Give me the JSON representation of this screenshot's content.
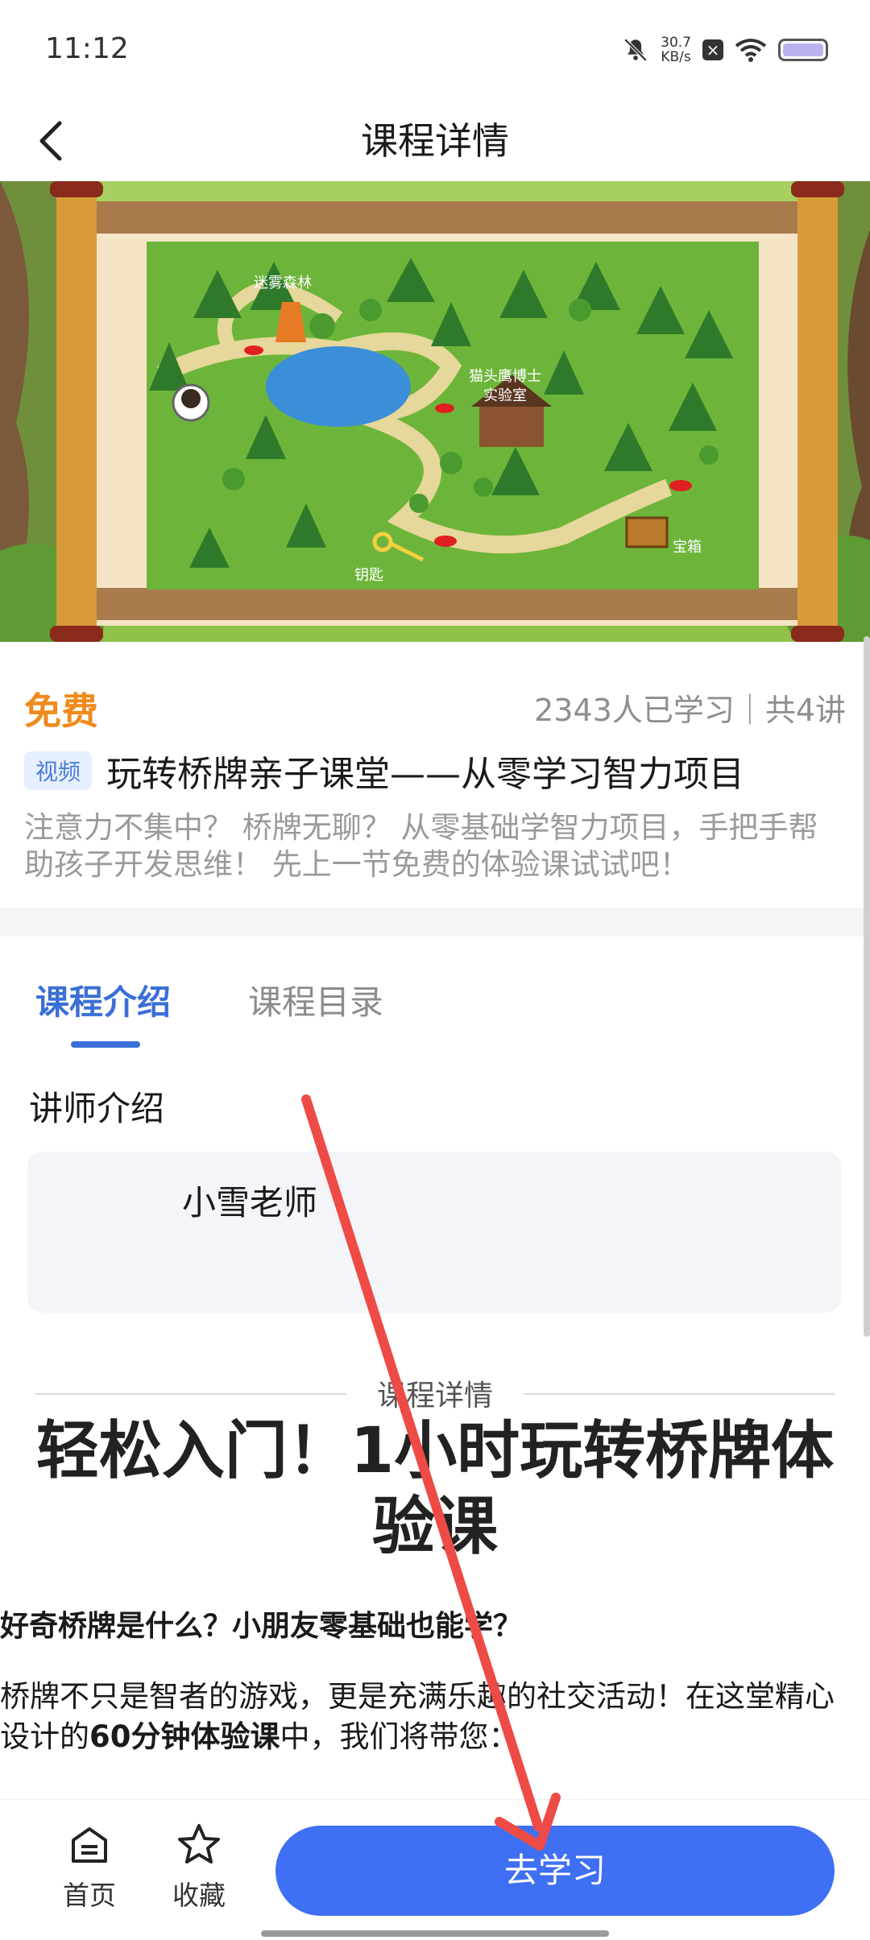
{
  "status": {
    "time": "11:12",
    "speed_value": "30.7",
    "speed_unit": "KB/s"
  },
  "nav": {
    "title": "课程详情"
  },
  "hero_map": {
    "labels": [
      "迷雾森林",
      "猫头鹰博士",
      "实验室",
      "钥匙",
      "宝箱"
    ]
  },
  "course": {
    "price": "免费",
    "stats": "2343人已学习｜共4讲",
    "tag": "视频",
    "title": "玩转桥牌亲子课堂——从零学习智力项目",
    "description": "注意力不集中？ 桥牌无聊？ 从零基础学智力项目，手把手帮助孩子开发思维！ 先上一节免费的体验课试试吧！"
  },
  "tabs": [
    {
      "label": "课程介绍",
      "active": true
    },
    {
      "label": "课程目录",
      "active": false
    }
  ],
  "teacher": {
    "section_label": "讲师介绍",
    "name": "小雪老师"
  },
  "detail": {
    "label": "课程详情",
    "headline": "轻松入门！1小时玩转桥牌体验课",
    "question": "好奇桥牌是什么？小朋友零基础也能学？",
    "para_before": "桥牌不只是智者的游戏，更是充满乐趣的社交活动！在这堂精心设计的",
    "para_bold": "60分钟体验课",
    "para_after": "中，我们将带您："
  },
  "bottom": {
    "home_label": "首页",
    "fav_label": "收藏",
    "learn_label": "去学习"
  },
  "colors": {
    "accent_blue": "#3f6ff2",
    "price_orange": "#f08a1c",
    "annotation_red": "#ee4b47"
  }
}
